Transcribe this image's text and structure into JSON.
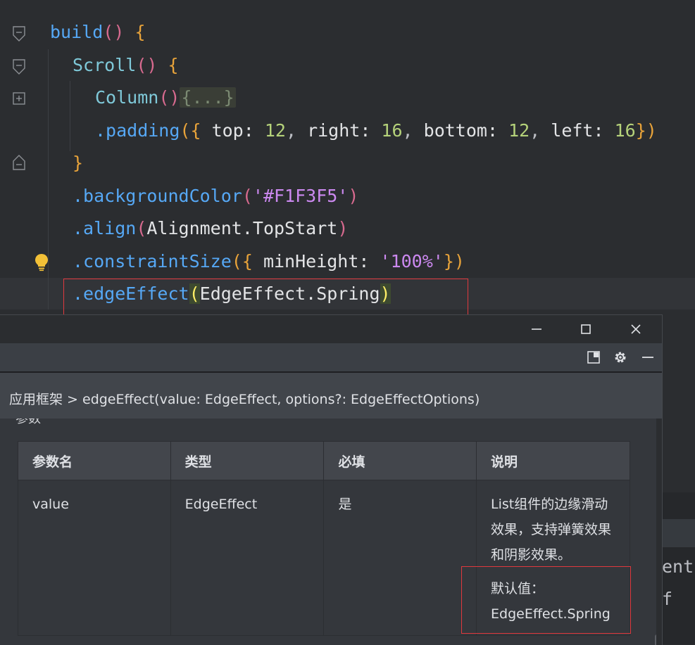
{
  "code": {
    "line1": {
      "fn": "build",
      "parens": "()",
      "brace": "{"
    },
    "line2": {
      "comp": "Scroll",
      "parens": "()",
      "brace": "{"
    },
    "line3": {
      "comp": "Column",
      "parens": "()",
      "folded": "{...}"
    },
    "line4": {
      "method": ".padding",
      "open": "({",
      "k1": " top: ",
      "v1": "12",
      "c1": ", ",
      "k2": "right: ",
      "v2": "16",
      "c2": ", ",
      "k3": "bottom: ",
      "v3": "12",
      "c3": ", ",
      "k4": "left: ",
      "v4": "16",
      "close": "})"
    },
    "line5": {
      "brace": "}"
    },
    "line6": {
      "method": ".backgroundColor",
      "open": "(",
      "str": "'#F1F3F5'",
      "close": ")"
    },
    "line7": {
      "method": ".align",
      "open": "(",
      "arg": "Alignment.TopStart",
      "close": ")"
    },
    "line8": {
      "method": ".constraintSize",
      "open": "({",
      "key": " minHeight: ",
      "str": "'100%'",
      "close": "})"
    },
    "line9": {
      "method": ".edgeEffect",
      "open": "(",
      "arg": "EdgeEffect.Spring",
      "close": ")"
    }
  },
  "right_fragments": {
    "frag1": "ent",
    "frag2": "f"
  },
  "popup": {
    "window_controls": {
      "minimize_icon": "minimize-icon",
      "maximize_icon": "maximize-icon",
      "close_icon": "close-icon"
    },
    "toolbar_icons": [
      "layout-toggle-icon",
      "gear-icon",
      "hide-panel-icon"
    ],
    "breadcrumb": "应用框架 > edgeEffect(value: EdgeEffect, options?: EdgeEffectOptions)",
    "cut_heading": "参数",
    "table": {
      "headers": [
        "参数名",
        "类型",
        "必填",
        "说明"
      ],
      "rows": [
        {
          "name": "value",
          "type": "EdgeEffect",
          "required": "是",
          "description": "List组件的边缘滑动效果，支持弹簧效果和阴影效果。",
          "default_text": "默认值：EdgeEffect.Spring"
        }
      ]
    }
  },
  "colors": {
    "editor_bg": "#2b2d30",
    "highlight_box": "#e0393e",
    "function": "#56a8f5",
    "string": "#cc89f0",
    "number": "#b5d27a"
  }
}
